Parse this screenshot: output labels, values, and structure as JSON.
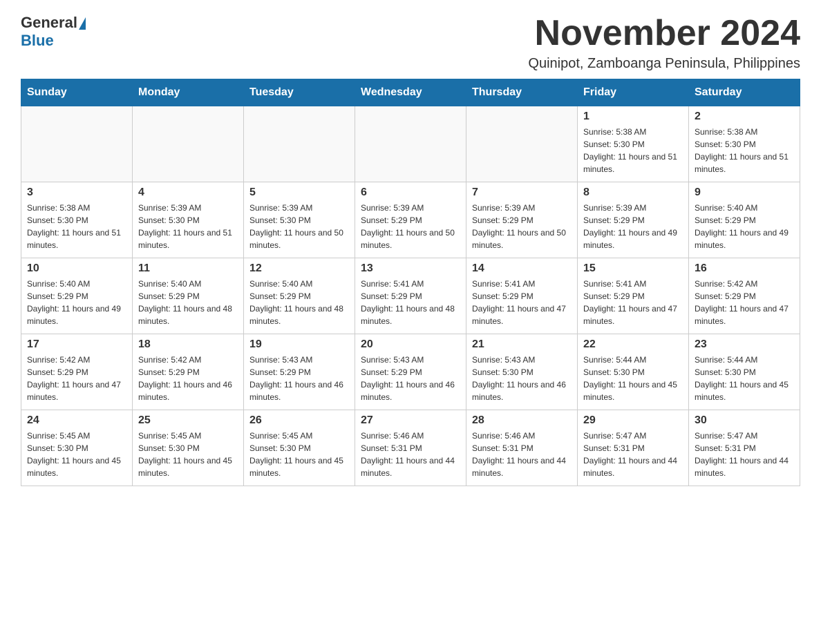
{
  "logo": {
    "general": "General",
    "blue": "Blue"
  },
  "header": {
    "title": "November 2024",
    "subtitle": "Quinipot, Zamboanga Peninsula, Philippines"
  },
  "days_of_week": [
    "Sunday",
    "Monday",
    "Tuesday",
    "Wednesday",
    "Thursday",
    "Friday",
    "Saturday"
  ],
  "weeks": [
    [
      {
        "day": "",
        "sunrise": "",
        "sunset": "",
        "daylight": ""
      },
      {
        "day": "",
        "sunrise": "",
        "sunset": "",
        "daylight": ""
      },
      {
        "day": "",
        "sunrise": "",
        "sunset": "",
        "daylight": ""
      },
      {
        "day": "",
        "sunrise": "",
        "sunset": "",
        "daylight": ""
      },
      {
        "day": "",
        "sunrise": "",
        "sunset": "",
        "daylight": ""
      },
      {
        "day": "1",
        "sunrise": "Sunrise: 5:38 AM",
        "sunset": "Sunset: 5:30 PM",
        "daylight": "Daylight: 11 hours and 51 minutes."
      },
      {
        "day": "2",
        "sunrise": "Sunrise: 5:38 AM",
        "sunset": "Sunset: 5:30 PM",
        "daylight": "Daylight: 11 hours and 51 minutes."
      }
    ],
    [
      {
        "day": "3",
        "sunrise": "Sunrise: 5:38 AM",
        "sunset": "Sunset: 5:30 PM",
        "daylight": "Daylight: 11 hours and 51 minutes."
      },
      {
        "day": "4",
        "sunrise": "Sunrise: 5:39 AM",
        "sunset": "Sunset: 5:30 PM",
        "daylight": "Daylight: 11 hours and 51 minutes."
      },
      {
        "day": "5",
        "sunrise": "Sunrise: 5:39 AM",
        "sunset": "Sunset: 5:30 PM",
        "daylight": "Daylight: 11 hours and 50 minutes."
      },
      {
        "day": "6",
        "sunrise": "Sunrise: 5:39 AM",
        "sunset": "Sunset: 5:29 PM",
        "daylight": "Daylight: 11 hours and 50 minutes."
      },
      {
        "day": "7",
        "sunrise": "Sunrise: 5:39 AM",
        "sunset": "Sunset: 5:29 PM",
        "daylight": "Daylight: 11 hours and 50 minutes."
      },
      {
        "day": "8",
        "sunrise": "Sunrise: 5:39 AM",
        "sunset": "Sunset: 5:29 PM",
        "daylight": "Daylight: 11 hours and 49 minutes."
      },
      {
        "day": "9",
        "sunrise": "Sunrise: 5:40 AM",
        "sunset": "Sunset: 5:29 PM",
        "daylight": "Daylight: 11 hours and 49 minutes."
      }
    ],
    [
      {
        "day": "10",
        "sunrise": "Sunrise: 5:40 AM",
        "sunset": "Sunset: 5:29 PM",
        "daylight": "Daylight: 11 hours and 49 minutes."
      },
      {
        "day": "11",
        "sunrise": "Sunrise: 5:40 AM",
        "sunset": "Sunset: 5:29 PM",
        "daylight": "Daylight: 11 hours and 48 minutes."
      },
      {
        "day": "12",
        "sunrise": "Sunrise: 5:40 AM",
        "sunset": "Sunset: 5:29 PM",
        "daylight": "Daylight: 11 hours and 48 minutes."
      },
      {
        "day": "13",
        "sunrise": "Sunrise: 5:41 AM",
        "sunset": "Sunset: 5:29 PM",
        "daylight": "Daylight: 11 hours and 48 minutes."
      },
      {
        "day": "14",
        "sunrise": "Sunrise: 5:41 AM",
        "sunset": "Sunset: 5:29 PM",
        "daylight": "Daylight: 11 hours and 47 minutes."
      },
      {
        "day": "15",
        "sunrise": "Sunrise: 5:41 AM",
        "sunset": "Sunset: 5:29 PM",
        "daylight": "Daylight: 11 hours and 47 minutes."
      },
      {
        "day": "16",
        "sunrise": "Sunrise: 5:42 AM",
        "sunset": "Sunset: 5:29 PM",
        "daylight": "Daylight: 11 hours and 47 minutes."
      }
    ],
    [
      {
        "day": "17",
        "sunrise": "Sunrise: 5:42 AM",
        "sunset": "Sunset: 5:29 PM",
        "daylight": "Daylight: 11 hours and 47 minutes."
      },
      {
        "day": "18",
        "sunrise": "Sunrise: 5:42 AM",
        "sunset": "Sunset: 5:29 PM",
        "daylight": "Daylight: 11 hours and 46 minutes."
      },
      {
        "day": "19",
        "sunrise": "Sunrise: 5:43 AM",
        "sunset": "Sunset: 5:29 PM",
        "daylight": "Daylight: 11 hours and 46 minutes."
      },
      {
        "day": "20",
        "sunrise": "Sunrise: 5:43 AM",
        "sunset": "Sunset: 5:29 PM",
        "daylight": "Daylight: 11 hours and 46 minutes."
      },
      {
        "day": "21",
        "sunrise": "Sunrise: 5:43 AM",
        "sunset": "Sunset: 5:30 PM",
        "daylight": "Daylight: 11 hours and 46 minutes."
      },
      {
        "day": "22",
        "sunrise": "Sunrise: 5:44 AM",
        "sunset": "Sunset: 5:30 PM",
        "daylight": "Daylight: 11 hours and 45 minutes."
      },
      {
        "day": "23",
        "sunrise": "Sunrise: 5:44 AM",
        "sunset": "Sunset: 5:30 PM",
        "daylight": "Daylight: 11 hours and 45 minutes."
      }
    ],
    [
      {
        "day": "24",
        "sunrise": "Sunrise: 5:45 AM",
        "sunset": "Sunset: 5:30 PM",
        "daylight": "Daylight: 11 hours and 45 minutes."
      },
      {
        "day": "25",
        "sunrise": "Sunrise: 5:45 AM",
        "sunset": "Sunset: 5:30 PM",
        "daylight": "Daylight: 11 hours and 45 minutes."
      },
      {
        "day": "26",
        "sunrise": "Sunrise: 5:45 AM",
        "sunset": "Sunset: 5:30 PM",
        "daylight": "Daylight: 11 hours and 45 minutes."
      },
      {
        "day": "27",
        "sunrise": "Sunrise: 5:46 AM",
        "sunset": "Sunset: 5:31 PM",
        "daylight": "Daylight: 11 hours and 44 minutes."
      },
      {
        "day": "28",
        "sunrise": "Sunrise: 5:46 AM",
        "sunset": "Sunset: 5:31 PM",
        "daylight": "Daylight: 11 hours and 44 minutes."
      },
      {
        "day": "29",
        "sunrise": "Sunrise: 5:47 AM",
        "sunset": "Sunset: 5:31 PM",
        "daylight": "Daylight: 11 hours and 44 minutes."
      },
      {
        "day": "30",
        "sunrise": "Sunrise: 5:47 AM",
        "sunset": "Sunset: 5:31 PM",
        "daylight": "Daylight: 11 hours and 44 minutes."
      }
    ]
  ]
}
